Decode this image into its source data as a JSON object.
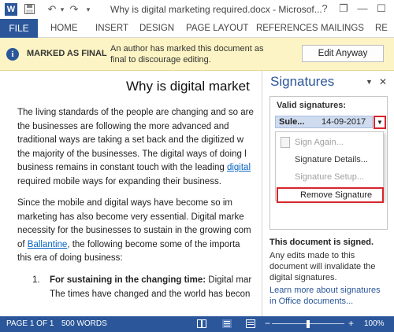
{
  "window": {
    "title": "Why is digital marketing required.docx - Microsof...",
    "app_icon": "W",
    "help": "?",
    "quick_access": {
      "undo_glyph": "↶",
      "redo_glyph": "↷",
      "dropdown_glyph": "▾",
      "save_glyph": "💾"
    },
    "controls": {
      "help": "?",
      "restore": "❐",
      "minimize": "—",
      "maximize": "☐",
      "close": "✕"
    }
  },
  "ribbon": {
    "file": "FILE",
    "tabs": [
      "HOME",
      "INSERT",
      "DESIGN",
      "PAGE LAYOUT",
      "REFERENCES",
      "MAILINGS",
      "RE"
    ],
    "scroll_glyph": "▶"
  },
  "infobar": {
    "icon": "i",
    "label": "MARKED AS FINAL",
    "message": "An author has marked this document as final to discourage editing.",
    "button": "Edit Anyway"
  },
  "document": {
    "title": "Why is digital market",
    "para1": [
      "The living standards of the people are changing and so are",
      "the businesses are following the more advanced and",
      "traditional ways are taking a set back and the digitized w",
      "the majority of the businesses. The digital ways of doing l",
      "business remains in constant touch with the leading",
      "required mobile ways for expanding their business."
    ],
    "para1_link": "digital",
    "para2": [
      "Since the mobile and digital ways have become so im",
      "marketing has also become very essential. Digital marke",
      "necessity for the businesses to sustain in the growing com",
      "of",
      ", the following become some of the importa",
      "this era of doing business:"
    ],
    "para2_link": "Ballantine",
    "list": {
      "number": "1.",
      "heading": "For sustaining in the changing time:",
      "text": "Digital mar",
      "line2": "The times have changed and the world has becon"
    }
  },
  "pane": {
    "title": "Signatures",
    "dropdown_glyph": "▼",
    "close_glyph": "✕",
    "valid_label": "Valid signatures:",
    "signature": {
      "name": "Sule...",
      "date": "14-09-2017",
      "arrow": "▼"
    },
    "menu": {
      "sign_again": "Sign Again...",
      "details": "Signature Details...",
      "setup": "Signature Setup...",
      "remove": "Remove Signature"
    },
    "signed_title": "This document is signed.",
    "signed_message": "Any edits made to this document will invalidate the digital signatures.",
    "learn_link": "Learn more about signatures in Office documents..."
  },
  "statusbar": {
    "page": "PAGE 1 OF 1",
    "words": "500 WORDS",
    "zoom": "100%",
    "minus": "−",
    "plus": "+"
  },
  "colors": {
    "accent": "#2b579a",
    "infobar_bg": "#fcf4c4",
    "highlight_red": "#d8252c",
    "selection_row": "#cfdcf0"
  }
}
